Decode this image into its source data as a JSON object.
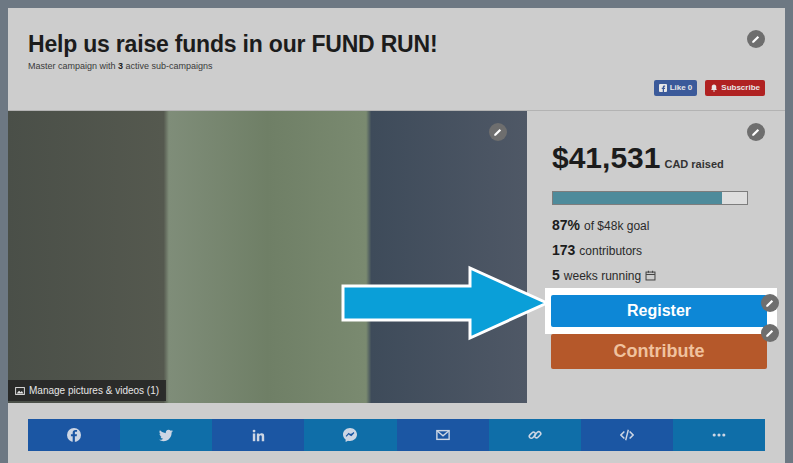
{
  "campaign": {
    "title": "Help us raise funds in our FUND RUN!",
    "subtitle_prefix": "Master campaign with ",
    "subtitle_count": "3",
    "subtitle_suffix": " active sub-campaigns"
  },
  "social": [
    {
      "label": "Like 0",
      "kind": "like"
    },
    {
      "label": "Subscribe",
      "kind": "subscribe"
    }
  ],
  "media": {
    "label": "Manage pictures & videos (1)"
  },
  "stats": {
    "amount": "$41,531",
    "currency_label": "CAD raised",
    "level": 0.87,
    "facts": [
      {
        "value": "87%",
        "label": "of $48k goal",
        "kind": "plain"
      },
      {
        "value": "173",
        "label": "contributors",
        "kind": "plain"
      },
      {
        "value": "5",
        "label": "weeks running",
        "kind": "calendar"
      }
    ]
  },
  "buttons": [
    {
      "label": "Register",
      "kind": "register",
      "highlighted": true
    },
    {
      "label": "Contribute",
      "kind": "contribute",
      "highlighted": false
    }
  ],
  "share": [
    {
      "kind": "facebook"
    },
    {
      "kind": "twitter"
    },
    {
      "kind": "linkedin"
    },
    {
      "kind": "messenger"
    },
    {
      "kind": "mail"
    },
    {
      "kind": "link"
    },
    {
      "kind": "embed"
    },
    {
      "kind": "more"
    }
  ]
}
